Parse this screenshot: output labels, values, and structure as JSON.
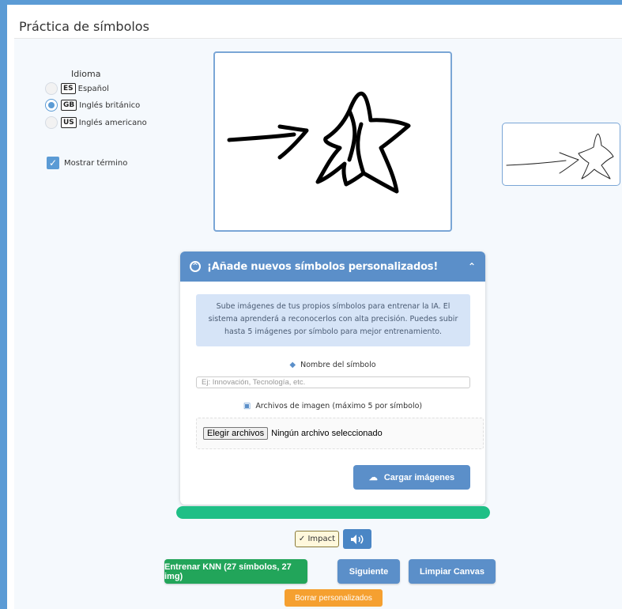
{
  "page": {
    "title": "Práctica de símbolos"
  },
  "language": {
    "label": "Idioma",
    "options": [
      {
        "code": "ES",
        "label": "Español",
        "selected": false
      },
      {
        "code": "GB",
        "label": "Inglés británico",
        "selected": true
      },
      {
        "code": "US",
        "label": "Inglés americano",
        "selected": false
      }
    ]
  },
  "show_term": {
    "label": "Mostrar término",
    "checked": true
  },
  "custom_symbols": {
    "header": "¡Añade nuevos símbolos personalizados!",
    "info": "Sube imágenes de tus propios símbolos para entrenar la IA. El sistema aprenderá a reconocerlos con alta precisión. Puedes subir hasta 5 imágenes por símbolo para mejor entrenamiento.",
    "name_label": "Nombre del símbolo",
    "name_placeholder": "Ej: Innovación, Tecnología, etc.",
    "files_label": "Archivos de imagen (máximo 5 por símbolo)",
    "file_button": "Elegir archivos",
    "file_status": "Ningún archivo seleccionado",
    "upload_button": "Cargar imágenes"
  },
  "progress": {
    "value": 1.0
  },
  "impact_label": "✓ Impact",
  "buttons": {
    "train": "Entrenar KNN (27 símbolos, 27 img)",
    "next": "Siguiente",
    "clear": "Limpiar Canvas",
    "delete_custom": "Borrar personalizados"
  },
  "icons": {
    "card_header": "chevron-circle-up-icon",
    "collapse": "chevron-up-icon",
    "tag": "tag-icon",
    "image": "image-icon",
    "upload": "cloud-upload-icon",
    "sound": "speaker-icon"
  },
  "colors": {
    "accent": "#5b8fc9",
    "success": "#22a55a",
    "progress": "#1fbf86",
    "warning": "#f5a030"
  }
}
